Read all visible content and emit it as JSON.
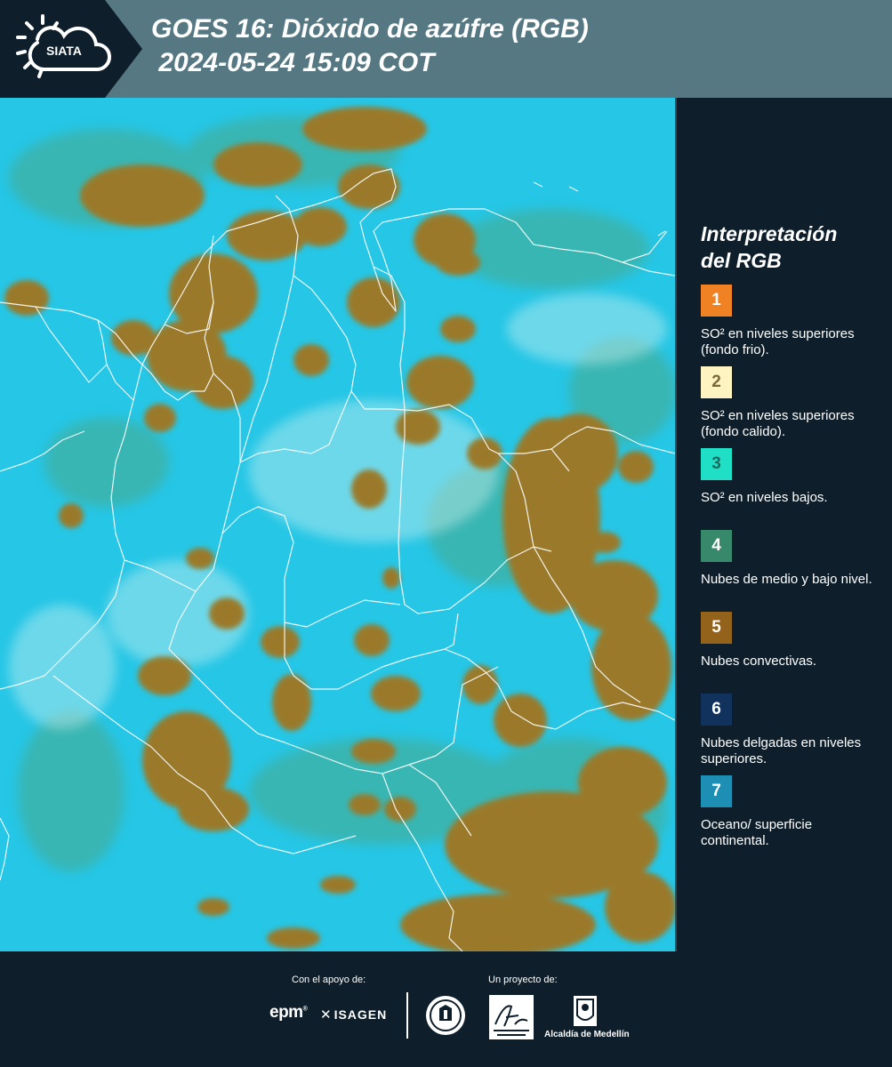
{
  "header": {
    "logo_text": "SIATA",
    "title": "GOES 16: Dióxido de azúfre (RGB)\n 2024-05-24 15:09 COT"
  },
  "map": {
    "image_type": "satellite-rgb-composite",
    "base_color": "#25c6e6",
    "cloud_color": "#9a7a2c",
    "low_cloud_color": "#3f9a7e",
    "border_color": "#ffffff"
  },
  "legend": {
    "title": "Interpretación\ndel RGB",
    "items": [
      {
        "number": "1",
        "color": "#f08224",
        "label": "SO² en niveles superiores (fondo frio)."
      },
      {
        "number": "2",
        "color": "#fdf4c2",
        "label": "SO² en niveles superiores (fondo calido)."
      },
      {
        "number": "3",
        "color": "#1fe0c6",
        "label": "SO² en niveles bajos."
      },
      {
        "number": "4",
        "color": "#36896a",
        "label": "Nubes de medio y bajo nivel."
      },
      {
        "number": "5",
        "color": "#93621b",
        "label": "Nubes convectivas."
      },
      {
        "number": "6",
        "color": "#12325e",
        "label": "Nubes delgadas en niveles superiores."
      },
      {
        "number": "7",
        "color": "#1e8fb4",
        "label": "Oceano/ superficie continental."
      }
    ]
  },
  "footer": {
    "support_label": "Con el apoyo de:",
    "project_label": "Un proyecto de:",
    "epm": "epm",
    "isagen": "ISAGEN",
    "alcaldia": "Alcaldía de Medellín"
  }
}
